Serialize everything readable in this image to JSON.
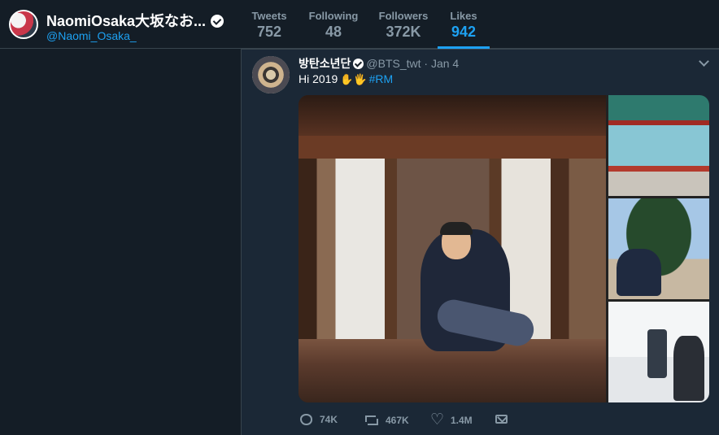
{
  "profile": {
    "name": "NaomiOsaka大坂なお...",
    "handle": "@Naomi_Osaka_"
  },
  "stats": [
    {
      "label": "Tweets",
      "value": "752"
    },
    {
      "label": "Following",
      "value": "48"
    },
    {
      "label": "Followers",
      "value": "372K"
    },
    {
      "label": "Likes",
      "value": "942",
      "active": true
    }
  ],
  "tweet": {
    "author_name": "방탄소년단",
    "author_handle": "@BTS_twt",
    "date": "· Jan 4",
    "text": "Hi 2019",
    "emoji": "✋🖐",
    "hashtag": "#RM",
    "replies": "74K",
    "retweets": "467K",
    "likes": "1.4M"
  },
  "colors": {
    "background": "#141d26",
    "tweet_background": "#1b2836",
    "accent": "#1da1f2",
    "muted": "#8899a6"
  },
  "icons": [
    "verified-badge-icon",
    "caret-down-icon",
    "reply-icon",
    "retweet-icon",
    "like-icon",
    "direct-message-icon"
  ]
}
